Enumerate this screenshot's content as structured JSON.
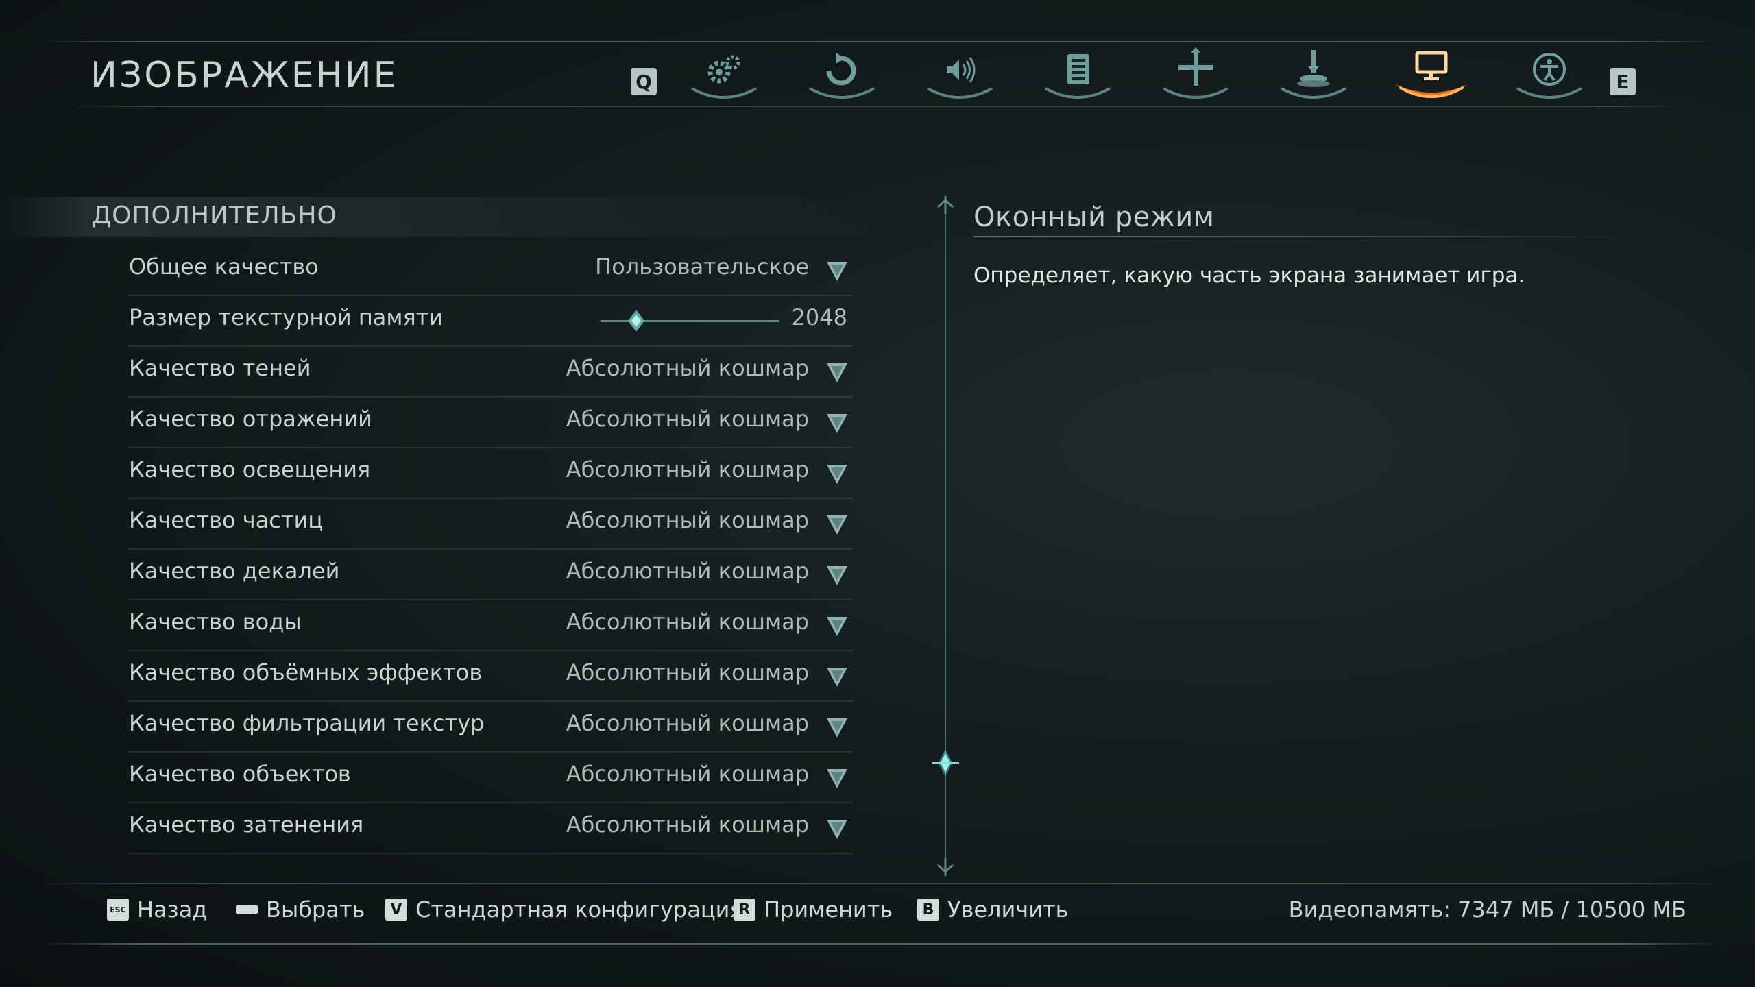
{
  "header": {
    "title": "ИЗОБРАЖЕНИЕ"
  },
  "tabs": {
    "prev_key": "Q",
    "next_key": "E",
    "items": [
      {
        "icon": "gears-icon",
        "active": false
      },
      {
        "icon": "camera-rotate-icon",
        "active": false
      },
      {
        "icon": "speaker-icon",
        "active": false
      },
      {
        "icon": "list-icon",
        "active": false
      },
      {
        "icon": "crosshair-icon",
        "active": false
      },
      {
        "icon": "joystick-icon",
        "active": false
      },
      {
        "icon": "monitor-icon",
        "active": true
      },
      {
        "icon": "accessibility-icon",
        "active": false
      }
    ],
    "active_color": "#ff7a1a"
  },
  "section": {
    "title": "ДОПОЛНИТЕЛЬНО"
  },
  "settings": [
    {
      "label": "Общее качество",
      "value": "Пользовательское",
      "type": "dropdown"
    },
    {
      "label": "Размер текстурной памяти",
      "value": "2048",
      "type": "slider",
      "level": 0.2
    },
    {
      "label": "Качество теней",
      "value": "Абсолютный кошмар",
      "type": "dropdown"
    },
    {
      "label": "Качество отражений",
      "value": "Абсолютный кошмар",
      "type": "dropdown"
    },
    {
      "label": "Качество освещения",
      "value": "Абсолютный кошмар",
      "type": "dropdown"
    },
    {
      "label": "Качество частиц",
      "value": "Абсолютный кошмар",
      "type": "dropdown"
    },
    {
      "label": "Качество декалей",
      "value": "Абсолютный кошмар",
      "type": "dropdown"
    },
    {
      "label": "Качество воды",
      "value": "Абсолютный кошмар",
      "type": "dropdown"
    },
    {
      "label": "Качество объёмных эффектов",
      "value": "Абсолютный кошмар",
      "type": "dropdown"
    },
    {
      "label": "Качество фильтрации текстур",
      "value": "Абсолютный кошмар",
      "type": "dropdown"
    },
    {
      "label": "Качество объектов",
      "value": "Абсолютный кошмар",
      "type": "dropdown"
    },
    {
      "label": "Качество затенения",
      "value": "Абсолютный кошмар",
      "type": "dropdown"
    }
  ],
  "description": {
    "title": "Оконный режим",
    "text": "Определяет, какую часть экрана занимает игра."
  },
  "scroll": {
    "position": 0.85
  },
  "footer": {
    "back": {
      "key": "ESC",
      "label": "Назад"
    },
    "select": {
      "key": "",
      "label": "Выбрать"
    },
    "default": {
      "key": "V",
      "label": "Стандартная конфигурация"
    },
    "apply": {
      "key": "R",
      "label": "Применить"
    },
    "zoom": {
      "key": "B",
      "label": "Увеличить"
    }
  },
  "vram": {
    "text": "Видеопамять: 7347 МБ / 10500 МБ"
  }
}
